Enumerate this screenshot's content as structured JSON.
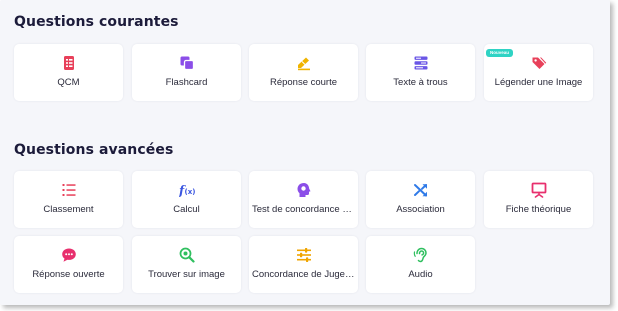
{
  "sections": {
    "common": {
      "title": "Questions courantes",
      "cards": [
        {
          "label": "QCM",
          "icon": "list-doc-icon",
          "color": "#e8405a"
        },
        {
          "label": "Flashcard",
          "icon": "cards-icon",
          "color": "#8b4ee8"
        },
        {
          "label": "Réponse courte",
          "icon": "pencil-icon",
          "color": "#f0b400"
        },
        {
          "label": "Texte à trous",
          "icon": "fields-icon",
          "color": "#6a56e6"
        },
        {
          "label": "Légender une Image",
          "icon": "tags-icon",
          "color": "#e8405a",
          "badge": "Nouveau"
        }
      ]
    },
    "advanced": {
      "title": "Questions avancées",
      "cards": [
        {
          "label": "Classement",
          "icon": "ordered-list-icon",
          "color": "#e8405a"
        },
        {
          "label": "Calcul",
          "icon": "function-icon",
          "color": "#3a55e0"
        },
        {
          "label": "Test de concordance de s...",
          "icon": "head-icon",
          "color": "#8b4ee8"
        },
        {
          "label": "Association",
          "icon": "shuffle-icon",
          "color": "#2f7ae8"
        },
        {
          "label": "Fiche théorique",
          "icon": "presentation-icon",
          "color": "#e8306e"
        },
        {
          "label": "Réponse ouverte",
          "icon": "speech-bubble-icon",
          "color": "#e8306e"
        },
        {
          "label": "Trouver sur image",
          "icon": "magnifier-icon",
          "color": "#2fbf5f"
        },
        {
          "label": "Concordance de Jugement",
          "icon": "sliders-icon",
          "color": "#f0a500"
        },
        {
          "label": "Audio",
          "icon": "ear-icon",
          "color": "#2fbf5f"
        }
      ]
    }
  }
}
